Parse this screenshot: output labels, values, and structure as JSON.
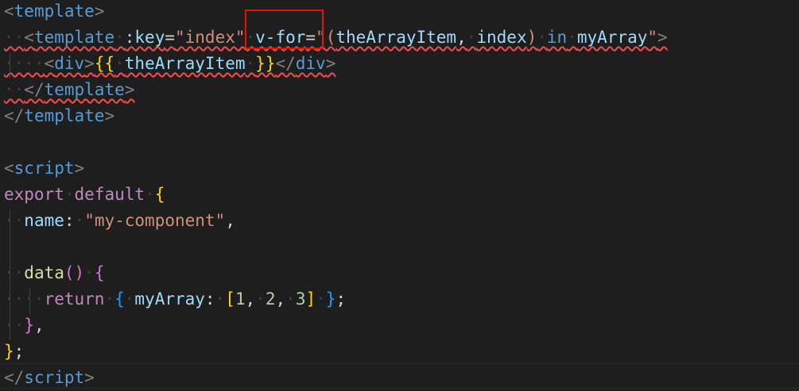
{
  "editor": {
    "language": "vue",
    "lines": [
      [
        {
          "t": "<",
          "c": "tag"
        },
        {
          "t": "template",
          "c": "tn"
        },
        {
          "t": ">",
          "c": "tag"
        }
      ],
      [
        {
          "t": "··",
          "c": "ws"
        },
        {
          "t": "<",
          "c": "tag"
        },
        {
          "t": "template",
          "c": "tn"
        },
        {
          "t": "·",
          "c": "ws"
        },
        {
          "t": ":key",
          "c": "attr"
        },
        {
          "t": "=",
          "c": ""
        },
        {
          "t": "\"index\"",
          "c": "str"
        },
        {
          "t": "·",
          "c": "ws"
        },
        {
          "t": "v-for",
          "c": "attr"
        },
        {
          "t": "=",
          "c": ""
        },
        {
          "t": "\"(",
          "c": "str"
        },
        {
          "t": "theArrayItem",
          "c": "var"
        },
        {
          "t": ",",
          "c": ""
        },
        {
          "t": "·",
          "c": "ws"
        },
        {
          "t": "index",
          "c": "var"
        },
        {
          "t": ")",
          "c": "str"
        },
        {
          "t": "·",
          "c": "ws"
        },
        {
          "t": "in",
          "c": "kw"
        },
        {
          "t": "·",
          "c": "ws"
        },
        {
          "t": "myArray",
          "c": "var"
        },
        {
          "t": "\"",
          "c": "str"
        },
        {
          "t": ">",
          "c": "tag"
        }
      ],
      [
        {
          "t": "····",
          "c": "ws"
        },
        {
          "t": "<",
          "c": "tag"
        },
        {
          "t": "div",
          "c": "tn"
        },
        {
          "t": ">",
          "c": "tag"
        },
        {
          "t": "{{",
          "c": "br1"
        },
        {
          "t": "·",
          "c": "ws"
        },
        {
          "t": "theArrayItem",
          "c": "var"
        },
        {
          "t": "·",
          "c": "ws"
        },
        {
          "t": "}}",
          "c": "br1"
        },
        {
          "t": "</",
          "c": "tag"
        },
        {
          "t": "div",
          "c": "tn"
        },
        {
          "t": ">",
          "c": "tag"
        }
      ],
      [
        {
          "t": "··",
          "c": "ws"
        },
        {
          "t": "</",
          "c": "tag"
        },
        {
          "t": "template",
          "c": "tn"
        },
        {
          "t": ">",
          "c": "tag"
        }
      ],
      [
        {
          "t": "</",
          "c": "tag"
        },
        {
          "t": "template",
          "c": "tn"
        },
        {
          "t": ">",
          "c": "tag"
        }
      ],
      [],
      [
        {
          "t": "<",
          "c": "tag"
        },
        {
          "t": "script",
          "c": "tn"
        },
        {
          "t": ">",
          "c": "tag"
        }
      ],
      [
        {
          "t": "export",
          "c": "kw2"
        },
        {
          "t": "·",
          "c": "ws"
        },
        {
          "t": "default",
          "c": "kw2"
        },
        {
          "t": "·",
          "c": "ws"
        },
        {
          "t": "{",
          "c": "br1"
        }
      ],
      [
        {
          "t": "··",
          "c": "ws"
        },
        {
          "t": "name",
          "c": "var"
        },
        {
          "t": ":",
          "c": ""
        },
        {
          "t": "·",
          "c": "ws"
        },
        {
          "t": "\"my-component\"",
          "c": "str"
        },
        {
          "t": ",",
          "c": ""
        }
      ],
      [],
      [
        {
          "t": "··",
          "c": "ws"
        },
        {
          "t": "data",
          "c": "fn"
        },
        {
          "t": "()",
          "c": "br2"
        },
        {
          "t": "·",
          "c": "ws"
        },
        {
          "t": "{",
          "c": "br2"
        }
      ],
      [
        {
          "t": "····",
          "c": "ws"
        },
        {
          "t": "return",
          "c": "kw2"
        },
        {
          "t": "·",
          "c": "ws"
        },
        {
          "t": "{",
          "c": "br3"
        },
        {
          "t": "·",
          "c": "ws"
        },
        {
          "t": "myArray",
          "c": "var"
        },
        {
          "t": ":",
          "c": ""
        },
        {
          "t": "·",
          "c": "ws"
        },
        {
          "t": "[",
          "c": "br1"
        },
        {
          "t": "1",
          "c": "num"
        },
        {
          "t": ",",
          "c": ""
        },
        {
          "t": "·",
          "c": "ws"
        },
        {
          "t": "2",
          "c": "num"
        },
        {
          "t": ",",
          "c": ""
        },
        {
          "t": "·",
          "c": "ws"
        },
        {
          "t": "3",
          "c": "num"
        },
        {
          "t": "]",
          "c": "br1"
        },
        {
          "t": "·",
          "c": "ws"
        },
        {
          "t": "}",
          "c": "br3"
        },
        {
          "t": ";",
          "c": ""
        }
      ],
      [
        {
          "t": "··",
          "c": "ws"
        },
        {
          "t": "}",
          "c": "br2"
        },
        {
          "t": ",",
          "c": ""
        }
      ],
      [
        {
          "t": "}",
          "c": "br1"
        },
        {
          "t": ";",
          "c": ""
        }
      ],
      [
        {
          "t": "</",
          "c": "tag"
        },
        {
          "t": "script",
          "c": "tn"
        },
        {
          "t": ">",
          "c": "tag"
        }
      ]
    ],
    "error_lines": [
      1,
      2,
      3
    ]
  },
  "colors": {
    "background": "#1e1e1e",
    "highlight_box": "#e51400",
    "error_squiggle": "#f14c4c"
  }
}
